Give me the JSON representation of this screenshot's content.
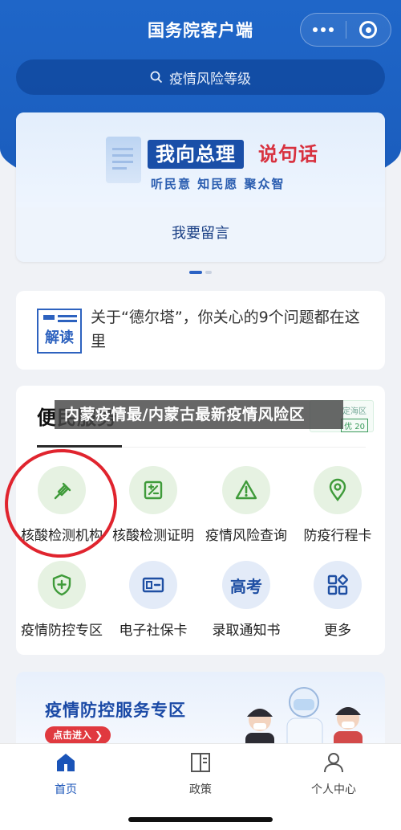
{
  "header": {
    "title": "国务院客户端",
    "search_placeholder": "疫情风险等级"
  },
  "banner": {
    "slogan_left": "我向总理",
    "slogan_right": "说句话",
    "sub_slogan": "听民意  知民愿  聚众智",
    "button_label": "我要留言"
  },
  "jiedu": {
    "icon_label": "解读",
    "text": "关于“德尔塔”，你关心的9个问题都在这里"
  },
  "services": {
    "title": "便民服务",
    "risk_tag_area": "定海区",
    "risk_tag_value": "优 20",
    "overlay_text": "内蒙疫情最/内蒙古最新疫情风险区",
    "items": [
      {
        "label": "核酸检测机构",
        "icon": "test-tube-icon"
      },
      {
        "label": "核酸检测证明",
        "icon": "certificate-icon"
      },
      {
        "label": "疫情风险查询",
        "icon": "warning-icon"
      },
      {
        "label": "防疫行程卡",
        "icon": "location-pin-icon"
      },
      {
        "label": "疫情防控专区",
        "icon": "shield-plus-icon"
      },
      {
        "label": "电子社保卡",
        "icon": "id-card-icon"
      },
      {
        "label": "录取通知书",
        "icon": "gaokao-icon",
        "icon_text": "高考"
      },
      {
        "label": "更多",
        "icon": "apps-grid-icon"
      }
    ]
  },
  "promo": {
    "title": "疫情防控服务专区",
    "button_label": "点击进入 ❯"
  },
  "tabbar": {
    "tabs": [
      {
        "label": "首页",
        "icon": "home-icon",
        "active": true
      },
      {
        "label": "政策",
        "icon": "book-icon",
        "active": false
      },
      {
        "label": "个人中心",
        "icon": "user-icon",
        "active": false
      }
    ]
  },
  "colors": {
    "primary": "#1f66c8",
    "accent_red": "#e0242e",
    "green_icon": "#3f9b3a",
    "blue_icon": "#1f4fa3"
  }
}
